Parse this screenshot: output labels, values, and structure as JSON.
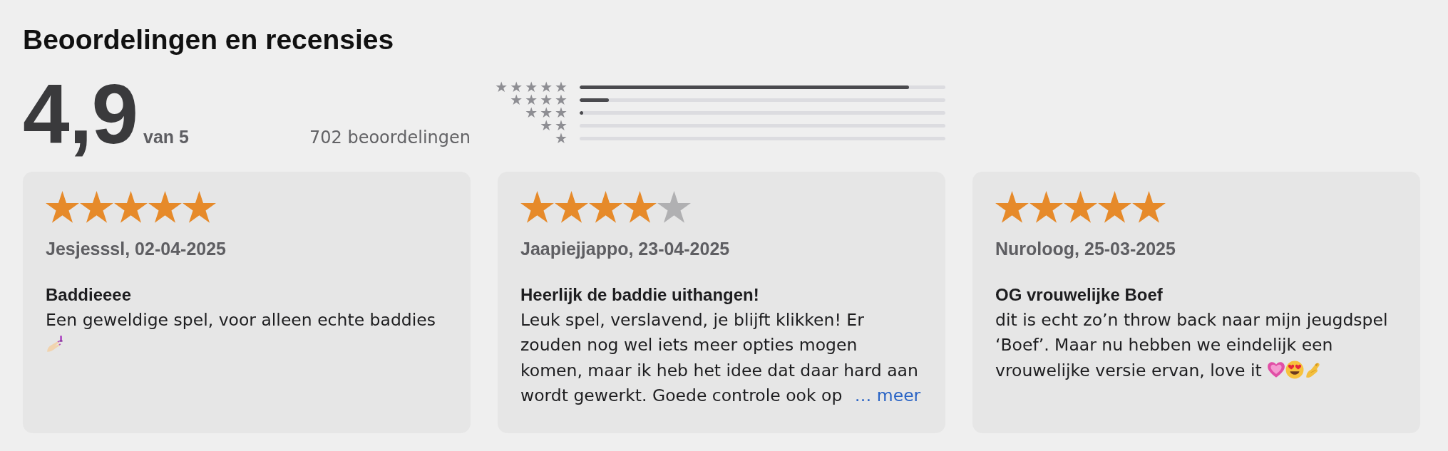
{
  "title": "Beoordelingen en recensies",
  "summary": {
    "score": "4,9",
    "out_of": "van 5",
    "count": "702 beoordelingen"
  },
  "histogram": [
    {
      "label": "★★★★★",
      "level": 0.9
    },
    {
      "label": "★★★★",
      "level": 0.08
    },
    {
      "label": "★★★",
      "level": 0.01
    },
    {
      "label": "★★"
    },
    {
      "label": "★"
    }
  ],
  "reviews": [
    {
      "stars": 5,
      "author": "Jesjesssl, 02-04-2025",
      "title": "Baddieeee",
      "body": "Een geweldige spel, voor alleen echte baddies",
      "emoji": [
        {
          "kind": "nailpolish"
        }
      ]
    },
    {
      "stars": 4,
      "author": "Jaapiejjappo, 23-04-2025",
      "title": "Heerlijk de baddie uithangen!",
      "body": "Leuk spel, verslavend, je blijft klikken! Er zouden nog wel iets meer opties mogen komen, maar ik heb het idee dat daar hard aan wordt gewerkt. Goede controle ook op",
      "more_link": "… meer"
    },
    {
      "stars": 5,
      "author": "Nuroloog, 25-03-2025",
      "title": "OG vrouwelijke Boef",
      "body": "dit is echt zo’n throw back naar mijn jeugdspel ‘Boef’. Maar nu hebben we eindelijk een vrouwelijke versie ervan, love it",
      "emoji": [
        {
          "kind": "heart"
        },
        {
          "kind": "hearteyes"
        },
        {
          "kind": "pinch"
        }
      ]
    }
  ]
}
